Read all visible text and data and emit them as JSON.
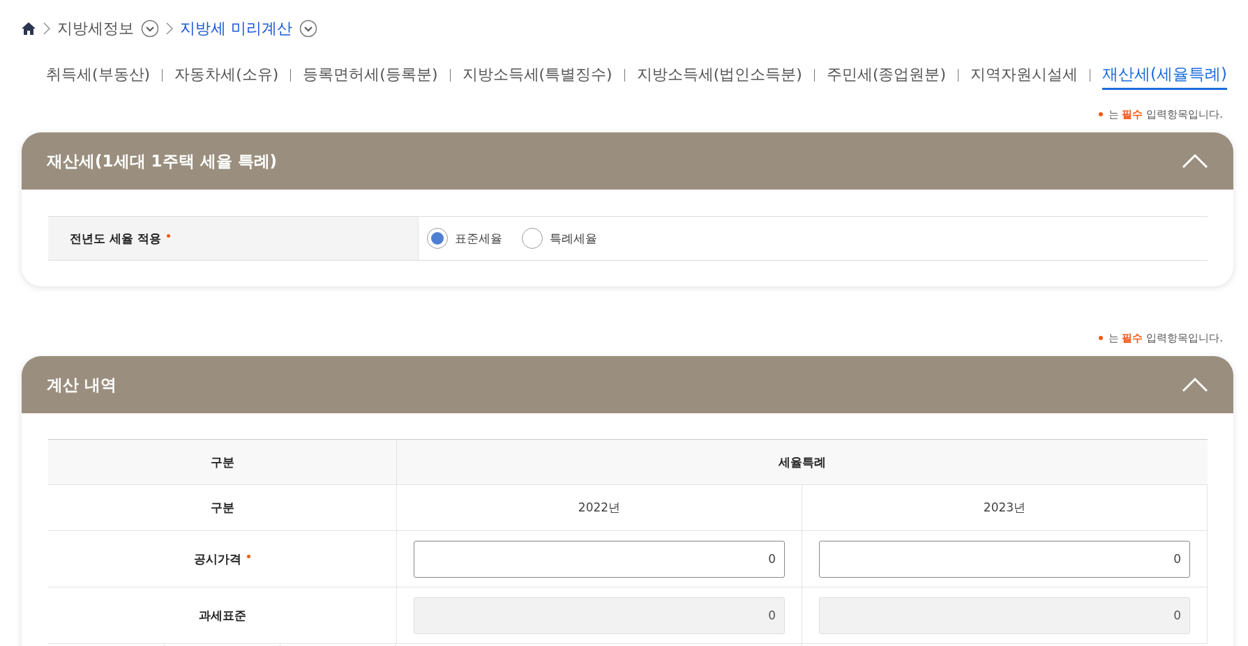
{
  "breadcrumb": [
    {
      "label": "지방세정보",
      "current": false
    },
    {
      "label": "지방세 미리계산",
      "current": true
    }
  ],
  "tabs": [
    {
      "label": "취득세(부동산)",
      "selected": false
    },
    {
      "label": "자동차세(소유)",
      "selected": false
    },
    {
      "label": "등록면허세(등록분)",
      "selected": false
    },
    {
      "label": "지방소득세(특별징수)",
      "selected": false
    },
    {
      "label": "지방소득세(법인소득분)",
      "selected": false
    },
    {
      "label": "주민세(종업원분)",
      "selected": false
    },
    {
      "label": "지역자원시설세",
      "selected": false
    },
    {
      "label": "재산세(세율특례)",
      "selected": true
    }
  ],
  "sections": [
    {
      "notice": "는 **필수** 입력항목입니다.",
      "title": "재산세(1세대 1주택 세율 특례)",
      "expanded": true,
      "kind": "radio-form",
      "rows": [
        {
          "label": "전년도 세율 적용",
          "required": true,
          "options": [
            {
              "label": "표준세율",
              "selected": true
            },
            {
              "label": "특례세율",
              "selected": false
            }
          ]
        }
      ]
    },
    {
      "notice": "는 **필수** 입력항목입니다.",
      "title": "계산 내역",
      "expanded": true,
      "kind": "calc-table",
      "table": {
        "header": [
          "구분",
          "세율특례"
        ],
        "subheader": [
          "구분",
          "2022년",
          "2023년"
        ],
        "rows": [
          {
            "label": "공시가격",
            "required": true,
            "fields": [
              {
                "value": "0",
                "disabled": false
              },
              {
                "value": "0",
                "disabled": false
              }
            ]
          },
          {
            "label": "과세표준",
            "required": false,
            "fields": [
              {
                "value": "0",
                "disabled": true
              },
              {
                "value": "0",
                "disabled": true
              }
            ]
          }
        ]
      }
    }
  ]
}
